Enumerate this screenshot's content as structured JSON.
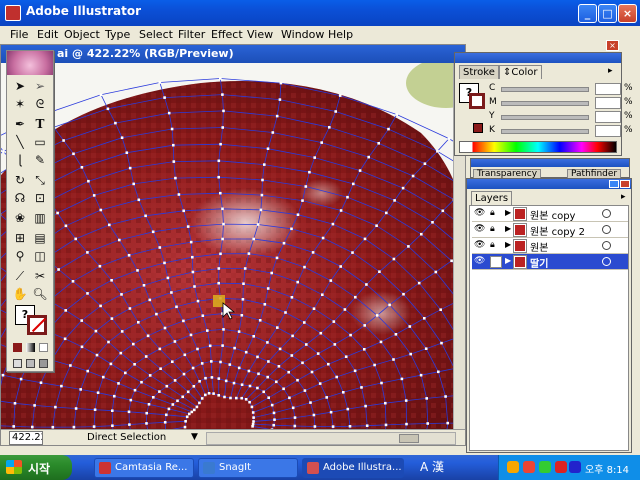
{
  "app": {
    "window_title": "Adobe Illustrator",
    "menu": [
      "File",
      "Edit",
      "Object",
      "Type",
      "Select",
      "Filter",
      "Effect",
      "View",
      "Window",
      "Help"
    ]
  },
  "document": {
    "title": "ai @ 422.22% (RGB/Preview)",
    "zoom": "422.22",
    "current_tool": "Direct Selection"
  },
  "color_panel": {
    "tabs": [
      "Stroke",
      "Color"
    ],
    "active_tab": "Color",
    "channels": [
      "C",
      "M",
      "Y",
      "K"
    ]
  },
  "transparency_panel": {
    "tabs": [
      "Transparency",
      "Pathfinder"
    ]
  },
  "layers_panel": {
    "tab": "Layers",
    "layers": [
      {
        "name": "원본 copy",
        "selected": false
      },
      {
        "name": "원본 copy 2",
        "selected": false
      },
      {
        "name": "원본",
        "selected": false
      },
      {
        "name": "딸기",
        "selected": true
      }
    ]
  },
  "taskbar": {
    "start_label": "시작",
    "tasks": [
      "Camtasia Re...",
      "SnagIt",
      "Adobe Illustra..."
    ],
    "ime": "A 漢",
    "clock": "오후 8:14"
  },
  "colors": {
    "accent": "#0b4fd6",
    "mesh_line": "#2a3adc",
    "fruit": "#8e1a1a"
  },
  "icons": [
    "selection-icon",
    "direct-selection-icon",
    "pen-icon",
    "type-icon",
    "line-icon",
    "rectangle-icon",
    "brush-icon",
    "pencil-icon",
    "rotate-icon",
    "scale-icon",
    "warp-icon",
    "free-transform-icon",
    "symbol-icon",
    "graph-icon",
    "mesh-icon",
    "gradient-icon",
    "eyedropper-icon",
    "scissors-icon",
    "hand-icon",
    "zoom-icon"
  ]
}
